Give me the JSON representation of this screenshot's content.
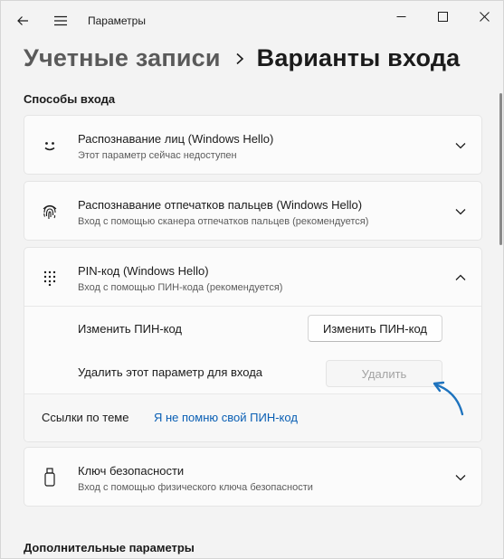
{
  "window": {
    "title": "Параметры",
    "back_icon": "arrow-left-icon",
    "menu_icon": "hamburger-icon",
    "controls": [
      "minimize-icon",
      "maximize-icon",
      "close-icon"
    ]
  },
  "header": {
    "parent": "Учетные записи",
    "current": "Варианты входа"
  },
  "sections": {
    "signin_methods": "Способы входа",
    "additional": "Дополнительные параметры"
  },
  "cards": [
    {
      "icon": "face-smile-icon",
      "title": "Распознавание лиц (Windows Hello)",
      "subtitle": "Этот параметр сейчас недоступен",
      "expanded": false
    },
    {
      "icon": "fingerprint-icon",
      "title": "Распознавание отпечатков пальцев (Windows Hello)",
      "subtitle": "Вход с помощью сканера отпечатков пальцев (рекомендуется)",
      "expanded": false
    },
    {
      "icon": "keypad-icon",
      "title": "PIN-код (Windows Hello)",
      "subtitle": "Вход с помощью ПИН-кода (рекомендуется)",
      "expanded": true
    },
    {
      "icon": "usb-key-icon",
      "title": "Ключ безопасности",
      "subtitle": "Вход с помощью физического ключа безопасности",
      "expanded": false
    }
  ],
  "pin": {
    "change_label": "Изменить ПИН-код",
    "change_button": "Изменить ПИН-код",
    "remove_label": "Удалить этот параметр для входа",
    "remove_button": "Удалить",
    "remove_enabled": false,
    "related_label": "Ссылки по теме",
    "related_link": "Я не помню свой ПИН-код"
  },
  "colors": {
    "accent": "#0a5fb4",
    "annotation_arrow": "#1e73be"
  }
}
